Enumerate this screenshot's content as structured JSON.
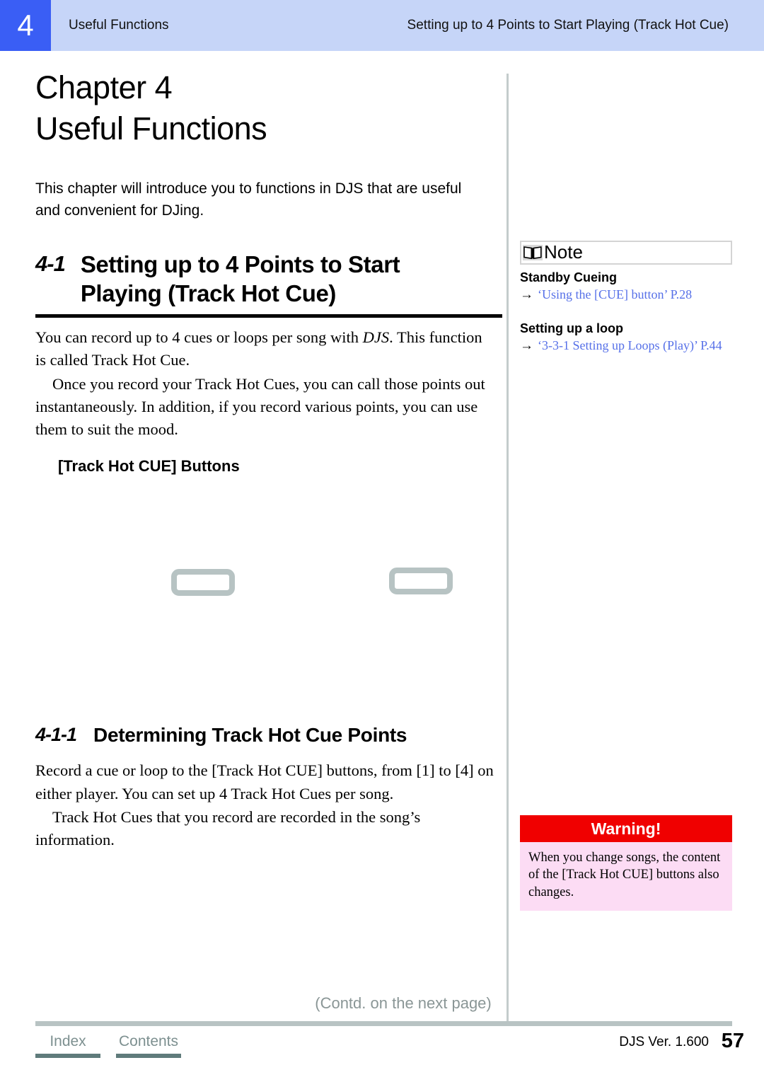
{
  "header": {
    "chapter_number": "4",
    "left_title": "Useful Functions",
    "right_title": "Setting up to 4 Points to Start Playing (Track Hot Cue)",
    "badge_color": "#3a5ef5",
    "bar_color": "#c6d5f8"
  },
  "chapter": {
    "line1": "Chapter 4",
    "line2": "Useful Functions",
    "intro": "This chapter will introduce you to functions in DJS that are useful and convenient for DJing."
  },
  "section_41": {
    "number": "4-1",
    "title_line1": "Setting up to 4 Points to Start",
    "title_line2": "Playing (Track Hot Cue)",
    "paragraph_1_pre": "You can record up to 4 cues or loops per song with ",
    "paragraph_1_italic": "DJS",
    "paragraph_1_post": ". This function is called Track Hot Cue.",
    "paragraph_2": "Once you record your Track Hot Cues, you can call those points out instantaneously. In addition, if you record various points, you can use them to suit the mood.",
    "figure_label": "[Track Hot CUE] Buttons"
  },
  "figure": {
    "button_outline_color": "#b7c3c3",
    "buttons": [
      {
        "name": "track-hot-cue-button-left"
      },
      {
        "name": "track-hot-cue-button-right"
      }
    ]
  },
  "section_411": {
    "number": "4-1-1",
    "title": "Determining Track Hot Cue Points",
    "paragraph_1": "Record a cue or loop to the [Track Hot CUE] buttons, from [1] to [4] on either player. You can set up 4 Track Hot Cues per song.",
    "paragraph_2": "Track Hot Cues that you record are recorded in the song’s information."
  },
  "note_box": {
    "title": "Note",
    "icon": "open-book-icon",
    "entries": [
      {
        "heading": "Standby Cueing",
        "arrow": "→",
        "link": "‘Using the [CUE] button’ P.28"
      },
      {
        "heading": "Setting up a loop",
        "arrow": "→",
        "link": "‘3-3-1  Setting up Loops (Play)’ P.44"
      }
    ],
    "link_color": "#5670e8"
  },
  "warning_box": {
    "title": "Warning!",
    "body": "When you change songs, the content of the [Track Hot CUE] buttons also changes.",
    "header_color": "#f00000",
    "body_color": "#fcdcf4"
  },
  "footer": {
    "contd": "(Contd. on the next page)",
    "links": [
      "Index",
      "Contents"
    ],
    "version": "DJS Ver. 1.600",
    "page_number": "57",
    "rule_color": "#b8c3c3",
    "link_color": "#7d9090"
  }
}
